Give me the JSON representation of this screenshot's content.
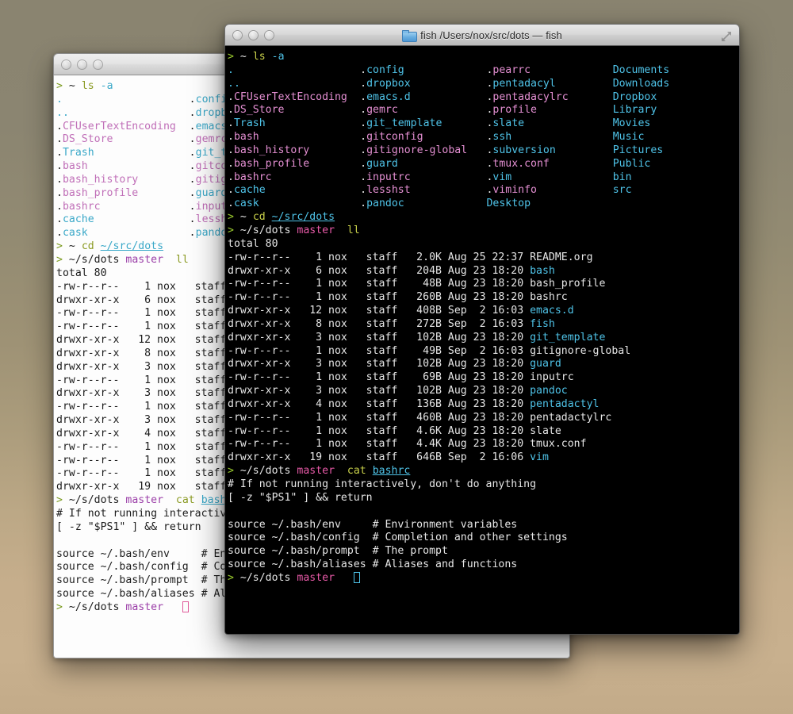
{
  "desktop": {
    "background_top": "#8a8470",
    "background_bottom": "#c3ab89"
  },
  "back_window": {
    "name": "background-terminal-window",
    "title": "",
    "theme": "light",
    "background": "#fdfdfd",
    "foreground": "#1c1c1c",
    "cursor_color": "#e05a9a"
  },
  "front_window": {
    "name": "foreground-terminal-window",
    "title": "fish  /Users/nox/src/dots — fish",
    "title_app": "fish",
    "title_path": "/Users/nox/src/dots — fish",
    "theme": "dark",
    "background": "#000000",
    "foreground": "#d8d8d8",
    "cursor_color": "#4fc3e8",
    "icons": {
      "folder": "folder-icon",
      "close": "close-button",
      "minimize": "minimize-button",
      "zoom": "zoom-button",
      "fullscreen": "fullscreen-icon"
    }
  },
  "session": {
    "prompt": {
      "arrow": ">",
      "home_cwd": "~",
      "repo_cwd": "~/s/dots",
      "branch": "master"
    },
    "commands": {
      "ls": "ls",
      "ls_flag": "-a",
      "cd": "cd",
      "cd_target": "~/src/dots",
      "ll": "ll",
      "cat": "cat",
      "cat_target": "bashrc"
    },
    "ls_output": {
      "columns": [
        [
          ".",
          "..",
          ".CFUserTextEncoding",
          ".DS_Store",
          ".Trash",
          ".bash",
          ".bash_history",
          ".bash_profile",
          ".bashrc",
          ".cache",
          ".cask"
        ],
        [
          ".config",
          ".dropbox",
          ".emacs.d",
          ".gemrc",
          ".git_template",
          ".gitconfig",
          ".gitignore-global",
          ".guard",
          ".inputrc",
          ".lesshst",
          ".pandoc"
        ],
        [
          ".pearrc",
          ".pentadacyl",
          ".pentadacylrc",
          ".profile",
          ".slate",
          ".ssh",
          ".subversion",
          ".tmux.conf",
          ".vim",
          ".viminfo",
          "Desktop"
        ],
        [
          "Documents",
          "Downloads",
          "Dropbox",
          "Library",
          "Movies",
          "Music",
          "Pictures",
          "Public",
          "bin",
          "src"
        ]
      ],
      "directories": [
        ".",
        "..",
        ".Trash",
        ".cache",
        ".cask",
        ".config",
        ".dropbox",
        ".emacs.d",
        ".git_template",
        ".guard",
        ".pandoc",
        ".pentadacyl",
        ".slate",
        ".ssh",
        ".subversion",
        ".vim",
        "Desktop",
        "Documents",
        "Downloads",
        "Dropbox",
        "Library",
        "Movies",
        "Music",
        "Pictures",
        "Public",
        "bin",
        "src"
      ]
    },
    "ll_output": {
      "total_label": "total 80",
      "rows": [
        {
          "perms": "-rw-r--r--",
          "links": "1",
          "user": "nox",
          "group": "staff",
          "size": "2.0K",
          "month": "Aug",
          "day": "25",
          "time": "22:37",
          "name": "README.org",
          "is_dir": false
        },
        {
          "perms": "drwxr-xr-x",
          "links": "6",
          "user": "nox",
          "group": "staff",
          "size": "204B",
          "month": "Aug",
          "day": "23",
          "time": "18:20",
          "name": "bash",
          "is_dir": true
        },
        {
          "perms": "-rw-r--r--",
          "links": "1",
          "user": "nox",
          "group": "staff",
          "size": "48B",
          "month": "Aug",
          "day": "23",
          "time": "18:20",
          "name": "bash_profile",
          "is_dir": false
        },
        {
          "perms": "-rw-r--r--",
          "links": "1",
          "user": "nox",
          "group": "staff",
          "size": "260B",
          "month": "Aug",
          "day": "23",
          "time": "18:20",
          "name": "bashrc",
          "is_dir": false
        },
        {
          "perms": "drwxr-xr-x",
          "links": "12",
          "user": "nox",
          "group": "staff",
          "size": "408B",
          "month": "Sep",
          "day": "2",
          "time": "16:03",
          "name": "emacs.d",
          "is_dir": true
        },
        {
          "perms": "drwxr-xr-x",
          "links": "8",
          "user": "nox",
          "group": "staff",
          "size": "272B",
          "month": "Sep",
          "day": "2",
          "time": "16:03",
          "name": "fish",
          "is_dir": true
        },
        {
          "perms": "drwxr-xr-x",
          "links": "3",
          "user": "nox",
          "group": "staff",
          "size": "102B",
          "month": "Aug",
          "day": "23",
          "time": "18:20",
          "name": "git_template",
          "is_dir": true
        },
        {
          "perms": "-rw-r--r--",
          "links": "1",
          "user": "nox",
          "group": "staff",
          "size": "49B",
          "month": "Sep",
          "day": "2",
          "time": "16:03",
          "name": "gitignore-global",
          "is_dir": false
        },
        {
          "perms": "drwxr-xr-x",
          "links": "3",
          "user": "nox",
          "group": "staff",
          "size": "102B",
          "month": "Aug",
          "day": "23",
          "time": "18:20",
          "name": "guard",
          "is_dir": true
        },
        {
          "perms": "-rw-r--r--",
          "links": "1",
          "user": "nox",
          "group": "staff",
          "size": "69B",
          "month": "Aug",
          "day": "23",
          "time": "18:20",
          "name": "inputrc",
          "is_dir": false
        },
        {
          "perms": "drwxr-xr-x",
          "links": "3",
          "user": "nox",
          "group": "staff",
          "size": "102B",
          "month": "Aug",
          "day": "23",
          "time": "18:20",
          "name": "pandoc",
          "is_dir": true
        },
        {
          "perms": "drwxr-xr-x",
          "links": "4",
          "user": "nox",
          "group": "staff",
          "size": "136B",
          "month": "Aug",
          "day": "23",
          "time": "18:20",
          "name": "pentadactyl",
          "is_dir": true
        },
        {
          "perms": "-rw-r--r--",
          "links": "1",
          "user": "nox",
          "group": "staff",
          "size": "460B",
          "month": "Aug",
          "day": "23",
          "time": "18:20",
          "name": "pentadactylrc",
          "is_dir": false
        },
        {
          "perms": "-rw-r--r--",
          "links": "1",
          "user": "nox",
          "group": "staff",
          "size": "4.6K",
          "month": "Aug",
          "day": "23",
          "time": "18:20",
          "name": "slate",
          "is_dir": false
        },
        {
          "perms": "-rw-r--r--",
          "links": "1",
          "user": "nox",
          "group": "staff",
          "size": "4.4K",
          "month": "Aug",
          "day": "23",
          "time": "18:20",
          "name": "tmux.conf",
          "is_dir": false
        },
        {
          "perms": "drwxr-xr-x",
          "links": "19",
          "user": "nox",
          "group": "staff",
          "size": "646B",
          "month": "Sep",
          "day": "2",
          "time": "16:06",
          "name": "vim",
          "is_dir": true
        }
      ]
    },
    "cat_output": [
      "# If not running interactively, don't do anything",
      "[ -z \"$PS1\" ] && return",
      "",
      "source ~/.bash/env     # Environment variables",
      "source ~/.bash/config  # Completion and other settings",
      "source ~/.bash/prompt  # The prompt",
      "source ~/.bash/aliases # Aliases and functions"
    ]
  }
}
